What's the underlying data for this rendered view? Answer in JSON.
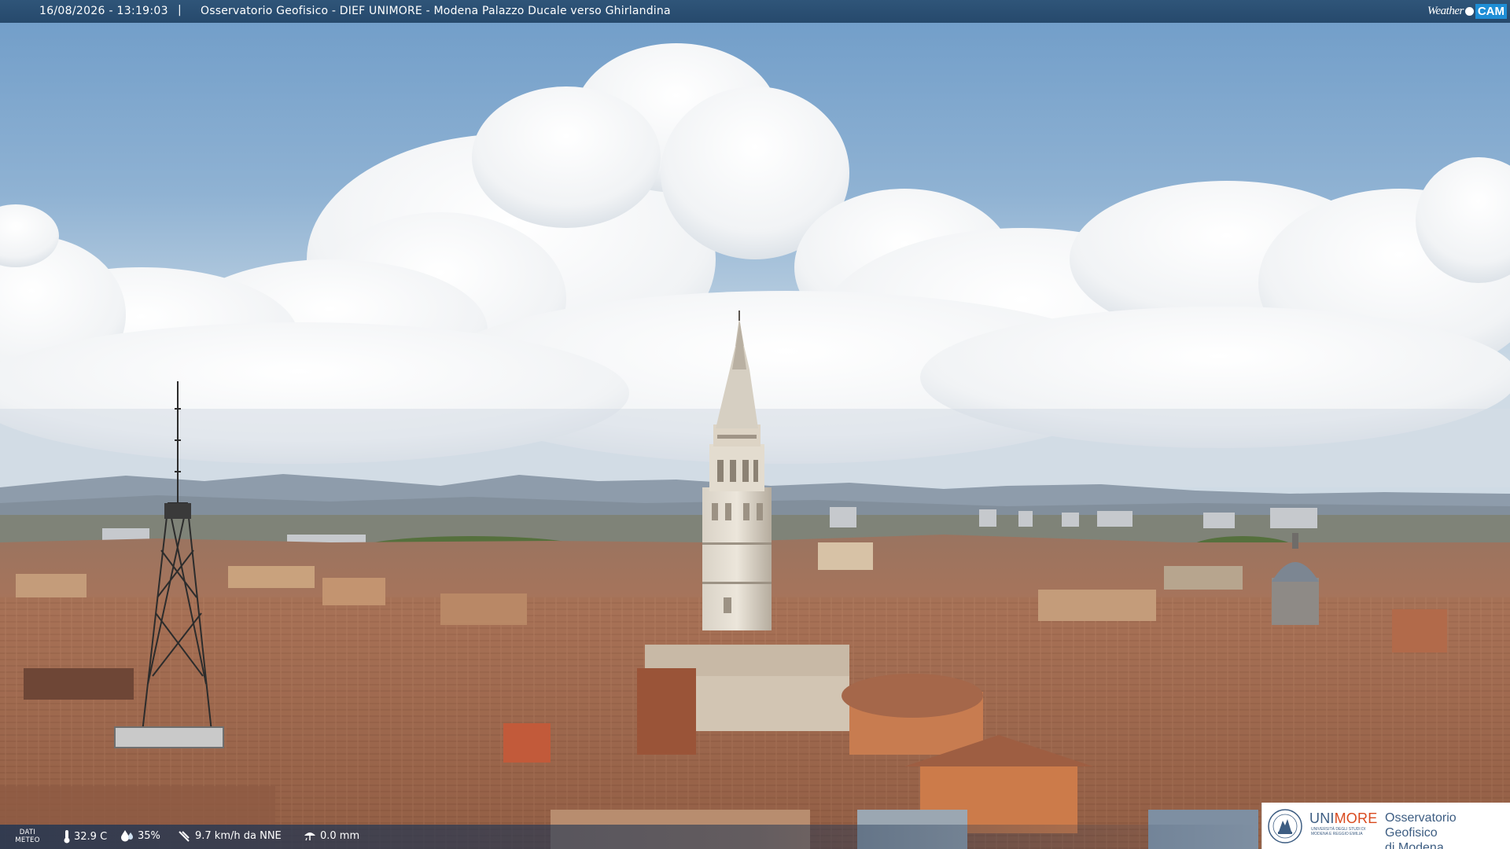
{
  "top_bar": {
    "timestamp": "16/08/2026 - 13:19:03",
    "separator": "|",
    "camera_title": "Osservatorio Geofisico - DIEF UNIMORE - Modena Palazzo Ducale verso Ghirlandina",
    "logo_left": "Weather",
    "logo_right": "CAM"
  },
  "weather_bar": {
    "label": "DATI METEO",
    "temperature": "32.9 C",
    "humidity": "35%",
    "wind": "9.7 km/h da NNE",
    "rain": "0.0 mm"
  },
  "logo_panel": {
    "wordmark_a": "UNI",
    "wordmark_b": "MORE",
    "wordmark_sub": "UNIVERSITÀ DEGLI STUDI DI MODENA E REGGIO EMILIA",
    "observatory_line1": "Osservatorio Geofisico",
    "observatory_line2": "di Modena"
  },
  "colors": {
    "bar_blue": "#2a4f74",
    "logo_cam_blue": "#1e8ed6",
    "unimore_blue": "#3d5d82",
    "unimore_orange": "#d94a1e"
  },
  "icons": [
    "thermometer-icon",
    "humidity-drop-icon",
    "wind-icon",
    "rain-gauge-icon",
    "unimore-emblem-icon"
  ]
}
